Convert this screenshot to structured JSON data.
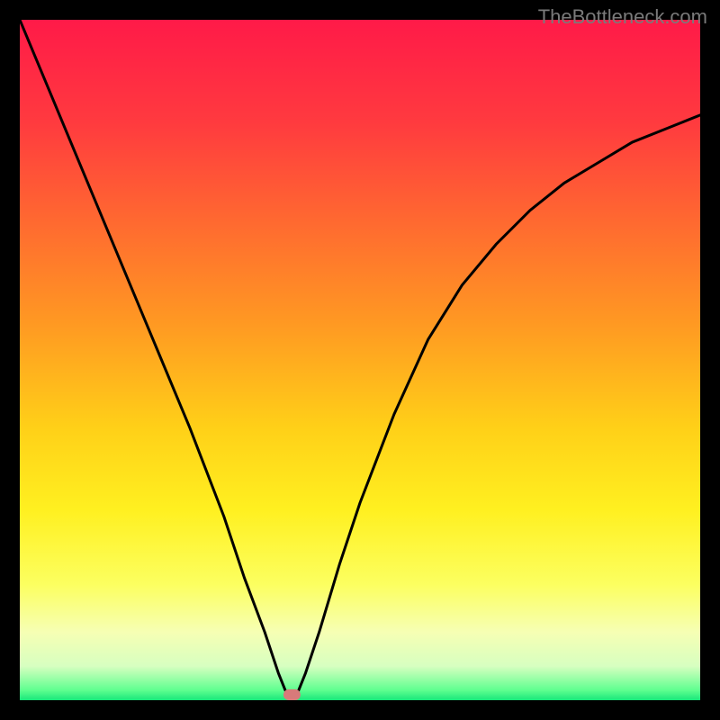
{
  "watermark": "TheBottleneck.com",
  "chart_data": {
    "type": "line",
    "title": "",
    "xlabel": "",
    "ylabel": "",
    "xlim": [
      0,
      100
    ],
    "ylim": [
      0,
      100
    ],
    "background": {
      "type": "vertical_gradient",
      "stops": [
        {
          "pos": 0.0,
          "color": "#ff1a48"
        },
        {
          "pos": 0.15,
          "color": "#ff3a3f"
        },
        {
          "pos": 0.3,
          "color": "#ff6a30"
        },
        {
          "pos": 0.45,
          "color": "#ff9a22"
        },
        {
          "pos": 0.6,
          "color": "#ffd018"
        },
        {
          "pos": 0.72,
          "color": "#fff020"
        },
        {
          "pos": 0.83,
          "color": "#fcff60"
        },
        {
          "pos": 0.9,
          "color": "#f6ffb4"
        },
        {
          "pos": 0.95,
          "color": "#d7ffc0"
        },
        {
          "pos": 0.985,
          "color": "#60ff90"
        },
        {
          "pos": 1.0,
          "color": "#18e77a"
        }
      ]
    },
    "series": [
      {
        "name": "bottleneck-curve",
        "color": "#000000",
        "x": [
          0,
          5,
          10,
          15,
          20,
          25,
          30,
          33,
          36,
          38,
          39,
          40,
          41,
          42,
          44,
          47,
          50,
          55,
          60,
          65,
          70,
          75,
          80,
          85,
          90,
          95,
          100
        ],
        "values": [
          100,
          88,
          76,
          64,
          52,
          40,
          27,
          18,
          10,
          4,
          1.5,
          0,
          1.5,
          4,
          10,
          20,
          29,
          42,
          53,
          61,
          67,
          72,
          76,
          79,
          82,
          84,
          86
        ]
      }
    ],
    "marker": {
      "name": "optimum-marker",
      "x": 40,
      "y": 0,
      "color": "#d87a7a",
      "shape": "rounded-rect",
      "w": 2.5,
      "h": 1.6
    }
  }
}
